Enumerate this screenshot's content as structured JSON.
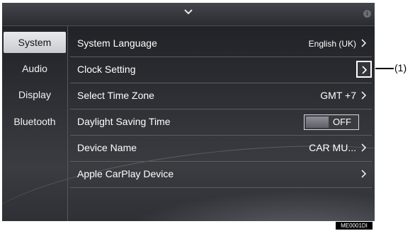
{
  "sidebar": {
    "items": [
      {
        "label": "System",
        "selected": true
      },
      {
        "label": "Audio",
        "selected": false
      },
      {
        "label": "Display",
        "selected": false
      },
      {
        "label": "Bluetooth",
        "selected": false
      }
    ]
  },
  "settings": {
    "rows": [
      {
        "label": "System Language",
        "value": "English (UK)"
      },
      {
        "label": "Clock Setting",
        "value": ""
      },
      {
        "label": "Select Time Zone",
        "value": "GMT +7"
      },
      {
        "label": "Daylight Saving Time",
        "toggle": "OFF"
      },
      {
        "label": "Device Name",
        "value": "CAR MU..."
      },
      {
        "label": "Apple CarPlay Device",
        "value": ""
      }
    ]
  },
  "callout": {
    "label": "(1)"
  },
  "figure_code": "ME0001DI",
  "icons": {
    "top": "chevron-down-icon",
    "info": "info-icon",
    "row_arrow": "chevron-right-icon"
  },
  "colors": {
    "background": "#2a2c31",
    "selected_tab": "#e0e1e3",
    "text": "#ffffff"
  }
}
